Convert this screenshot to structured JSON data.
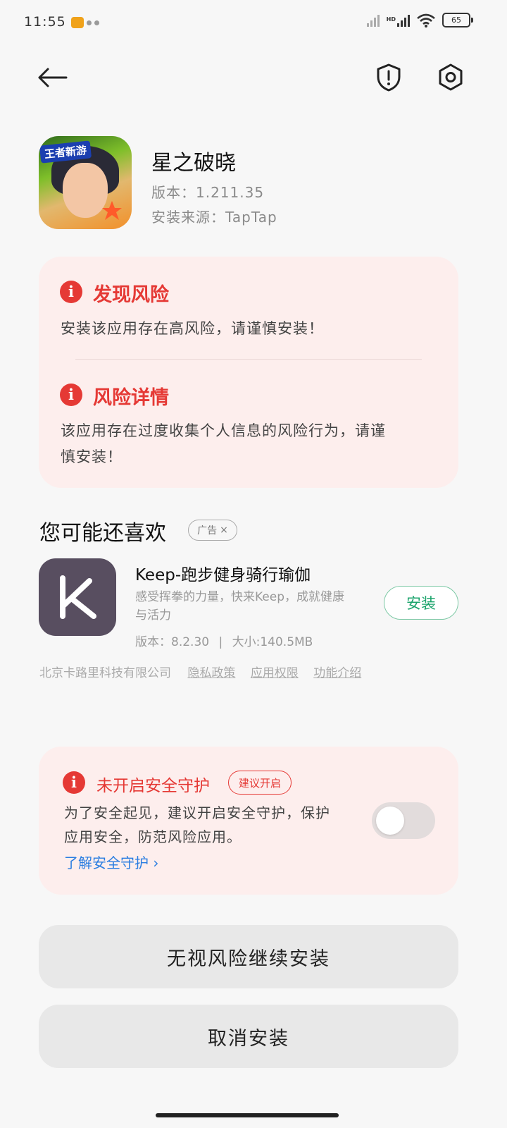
{
  "status_bar": {
    "time": "11:55",
    "battery": "65",
    "network_label": "HD"
  },
  "app": {
    "name": "星之破晓",
    "version_label": "版本：",
    "version": "1.211.35",
    "source_label": "安装来源：",
    "source": "TapTap",
    "icon_tag": "王者新游"
  },
  "risk": {
    "found_title": "发现风险",
    "found_text": "安装该应用存在高风险，请谨慎安装！",
    "detail_title": "风险详情",
    "detail_text_line1": "该应用存在过度收集个人信息的风险行为，请谨",
    "detail_text_line2": "慎安装！",
    "icon_glyph": "i"
  },
  "recommend": {
    "title": "您可能还喜欢",
    "ad_label": "广告",
    "ad_close": "×",
    "app_name": "Keep-跑步健身骑行瑜伽",
    "app_desc_line1": "感受挥拳的力量，快来Keep，成就健康",
    "app_desc_line2": "与活力",
    "app_version": "版本：8.2.30",
    "app_size": "大小:140.5MB",
    "separator": "|",
    "install_label": "安装",
    "company": "北京卡路里科技有限公司",
    "privacy_link": "隐私政策",
    "permission_link": "应用权限",
    "intro_link": "功能介绍"
  },
  "protect": {
    "title": "未开启安全守护",
    "suggest_chip": "建议开启",
    "text_line1": "为了安全起见，建议开启安全守护，保护",
    "text_line2": "应用安全，防范风险应用。",
    "learn_link": "了解安全守护",
    "toggle_on": false
  },
  "buttons": {
    "continue": "无视风险继续安装",
    "cancel": "取消安装"
  },
  "colors": {
    "danger": "#e53935",
    "card_bg": "#fdeeed",
    "link": "#2a7de1",
    "install_green": "#1aa36b",
    "keep_bg": "#584e60"
  }
}
